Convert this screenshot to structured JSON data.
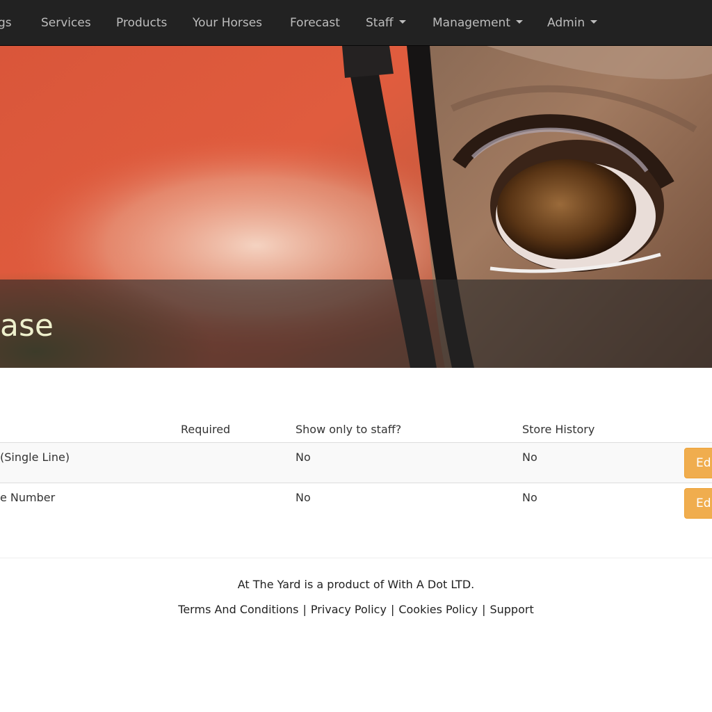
{
  "navbar": {
    "items": [
      {
        "label": "gs"
      },
      {
        "label": "Services"
      },
      {
        "label": "Products"
      },
      {
        "label": "Your Horses"
      },
      {
        "label": "Forecast"
      },
      {
        "label": "Staff"
      },
      {
        "label": "Management"
      },
      {
        "label": "Admin"
      }
    ]
  },
  "hero": {
    "title": "ase"
  },
  "table": {
    "headers": [
      "Required",
      "Show only to staff?",
      "Store History"
    ],
    "rows": [
      {
        "name": "(Single Line)",
        "required": "",
        "staff_only": "No",
        "store_history": "No",
        "action": "Ed"
      },
      {
        "name": "e Number",
        "required": "",
        "staff_only": "No",
        "store_history": "No",
        "action": "Ed"
      }
    ]
  },
  "footer": {
    "line1": "At The Yard is a product of With A Dot LTD.",
    "links": [
      "Terms And Conditions",
      "Privacy Policy",
      "Cookies Policy",
      "Support"
    ],
    "separator": "|"
  },
  "colors": {
    "navbar_bg": "#222222",
    "edit_button": "#f0ad4e",
    "hero_title": "#eef0cc"
  }
}
